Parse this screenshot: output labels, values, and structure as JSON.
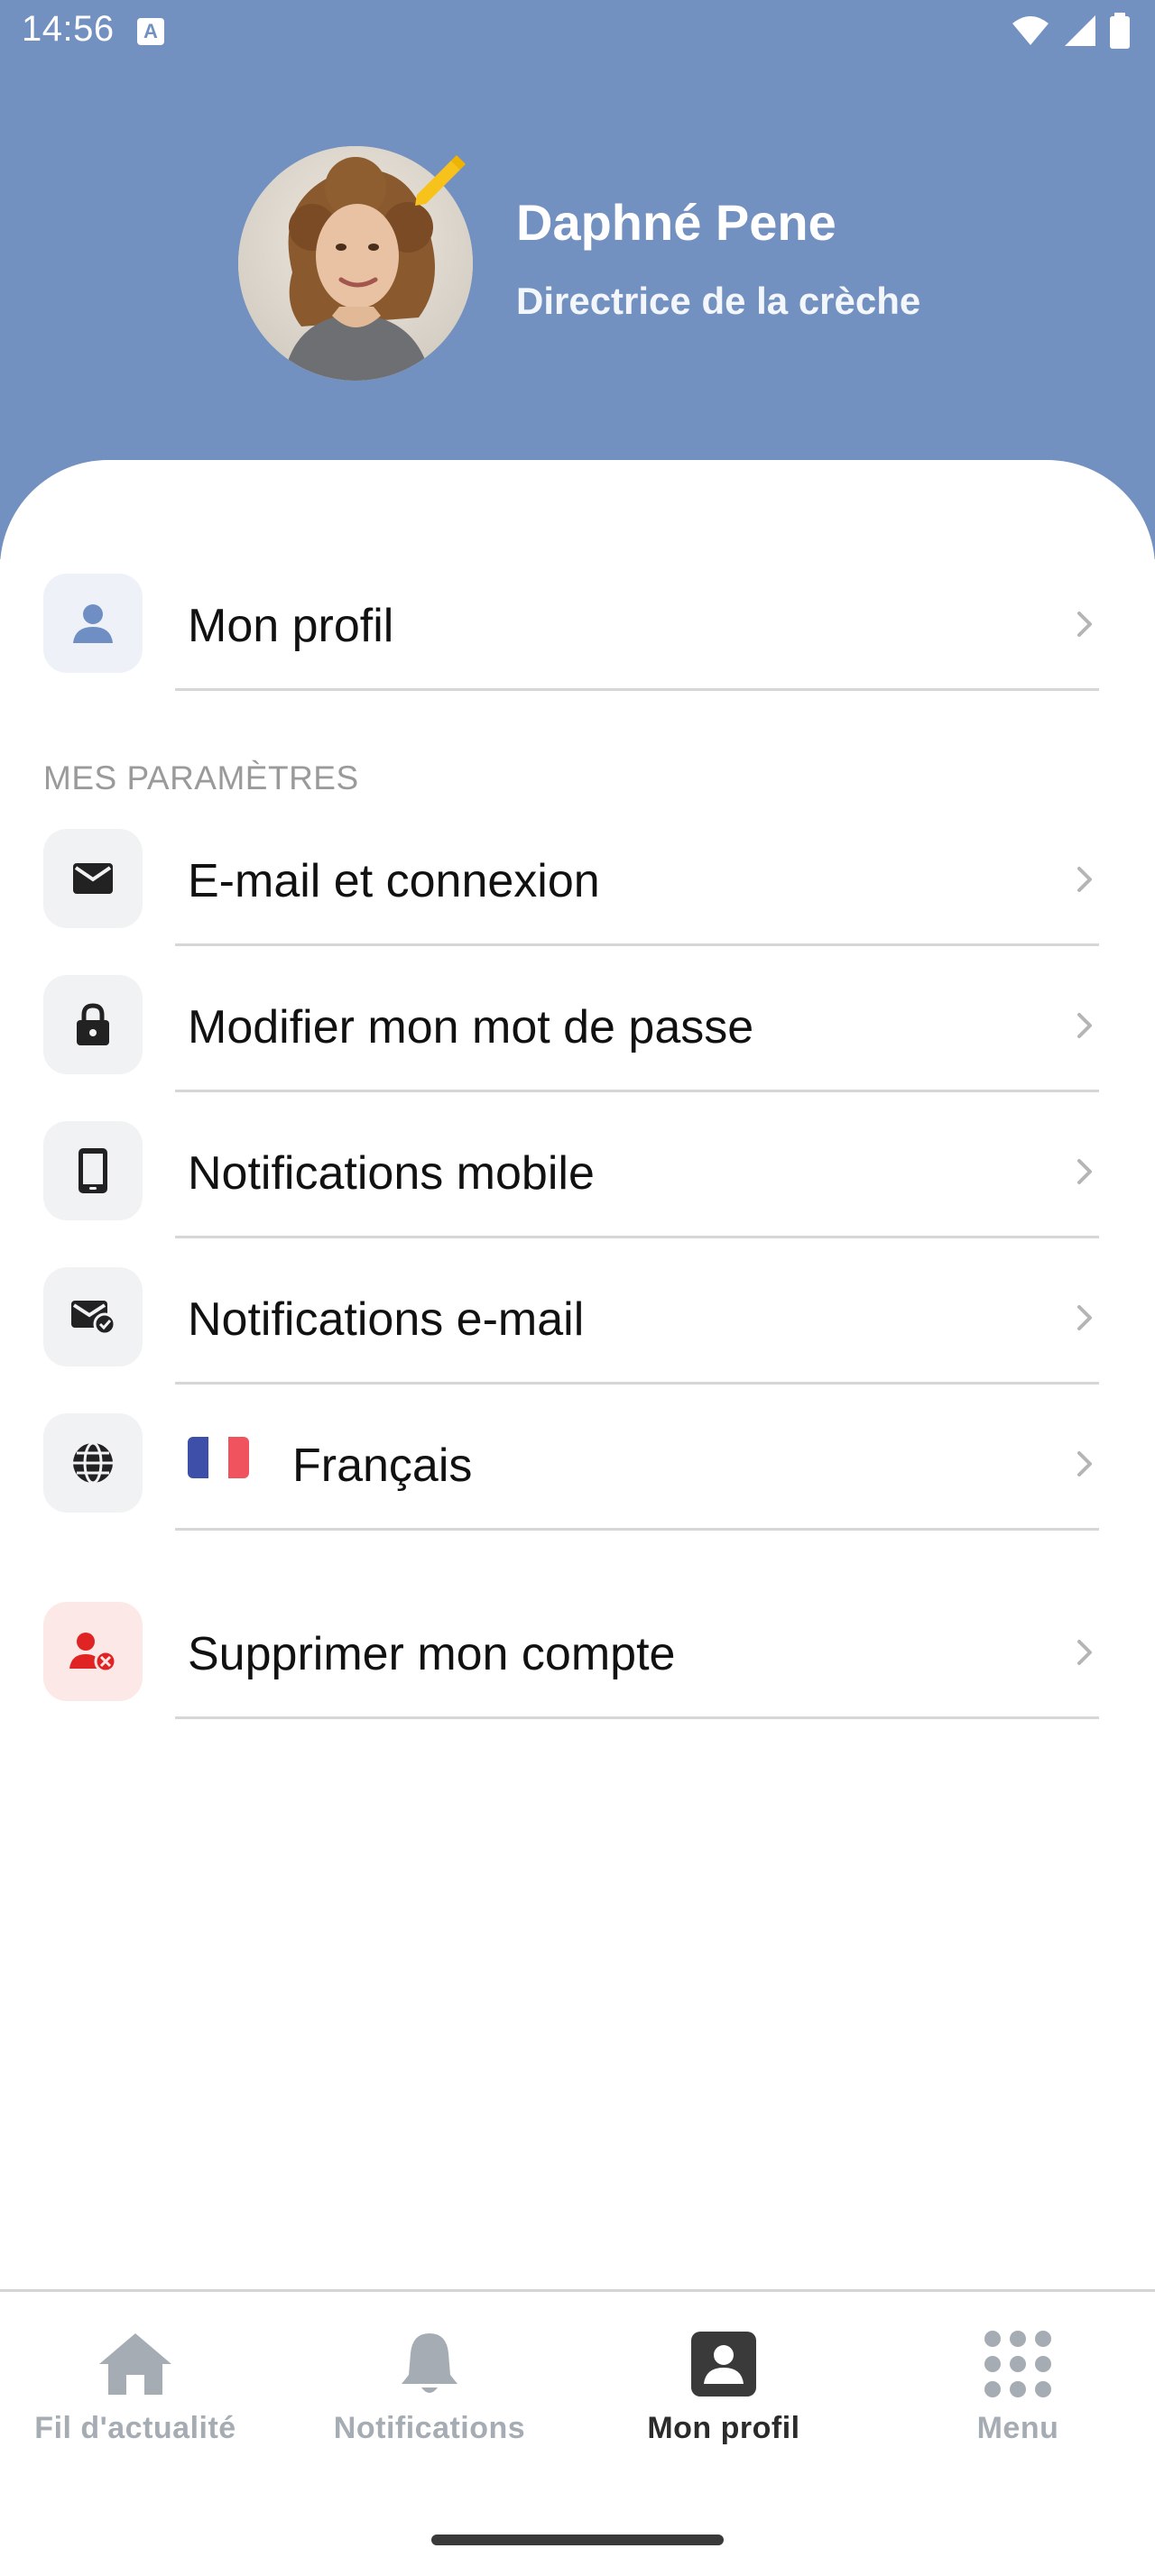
{
  "status_bar": {
    "time": "14:56"
  },
  "profile": {
    "name": "Daphné Pene",
    "role": "Directrice de la crèche"
  },
  "menu": {
    "my_profile": "Mon profil",
    "section_title": "MES PARAMÈTRES",
    "email_login": "E-mail et connexion",
    "change_password": "Modifier mon mot de passe",
    "mobile_notifications": "Notifications mobile",
    "email_notifications": "Notifications e-mail",
    "language": "Français",
    "delete_account": "Supprimer mon compte"
  },
  "bottom_nav": {
    "items": [
      {
        "label": "Fil d'actualité",
        "icon": "home-icon",
        "active": false
      },
      {
        "label": "Notifications",
        "icon": "bell-icon",
        "active": false
      },
      {
        "label": "Mon profil",
        "icon": "profile-card-icon",
        "active": true
      },
      {
        "label": "Menu",
        "icon": "grid-icon",
        "active": false
      }
    ]
  },
  "colors": {
    "header_bg": "#7391c0",
    "accent_blue": "#6f8fc4",
    "danger_red": "#e02424",
    "danger_bg": "#fde8e8",
    "pencil_yellow": "#f7c21a"
  }
}
